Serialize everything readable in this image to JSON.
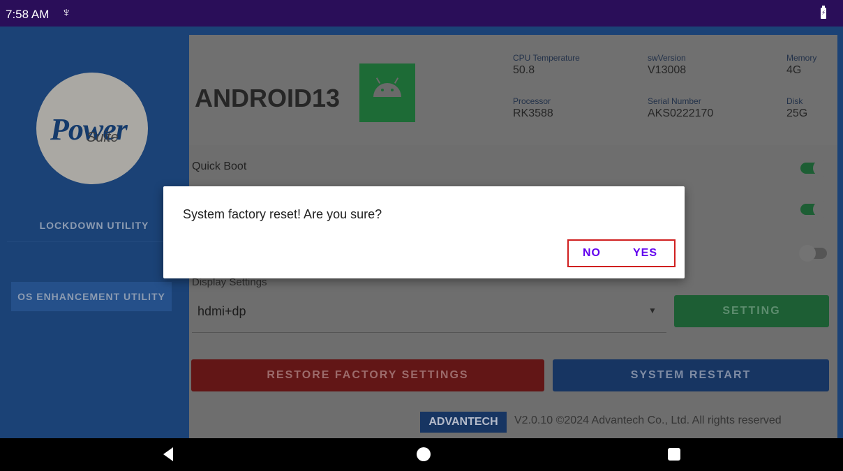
{
  "status_bar": {
    "time": "7:58 AM",
    "usb_icon": "usb-icon",
    "battery_icon": "battery-charging-icon"
  },
  "sidebar": {
    "logo": {
      "power": "Power",
      "suite": "Suite"
    },
    "items": [
      {
        "label": "LOCKDOWN UTILITY"
      },
      {
        "label": "OS ENHANCEMENT UTILITY"
      }
    ]
  },
  "header": {
    "title": "ANDROID13",
    "icon": "android-icon",
    "info": {
      "cpu_temp": {
        "label": "CPU Temperature",
        "value": "50.8"
      },
      "sw_version": {
        "label": "swVersion",
        "value": "V13008"
      },
      "memory": {
        "label": "Memory",
        "value": "4G"
      },
      "processor": {
        "label": "Processor",
        "value": "RK3588"
      },
      "serial": {
        "label": "Serial Number",
        "value": "AKS0222170"
      },
      "disk": {
        "label": "Disk",
        "value": "25G"
      }
    }
  },
  "settings": {
    "quick_boot": {
      "label": "Quick Boot",
      "on": true
    },
    "toggle_2": {
      "on": true
    },
    "toggle_3": {
      "on": false
    }
  },
  "display": {
    "label": "Display Settings",
    "selected": "hdmi+dp",
    "setting_button": "SETTING"
  },
  "actions": {
    "restore": "RESTORE FACTORY SETTINGS",
    "restart": "SYSTEM RESTART"
  },
  "footer": {
    "brand": "ADVANTECH",
    "copyright": "V2.0.10 ©2024 Advantech Co., Ltd.  All rights reserved"
  },
  "dialog": {
    "message": "System factory reset! Are you sure?",
    "no": "NO",
    "yes": "YES"
  },
  "colors": {
    "status_bar": "#2a0e59",
    "sidebar": "#1b4276",
    "dialog_button": "#6200ee",
    "highlight_box": "#d01f1f",
    "toggle_on": "#1d5e34"
  }
}
